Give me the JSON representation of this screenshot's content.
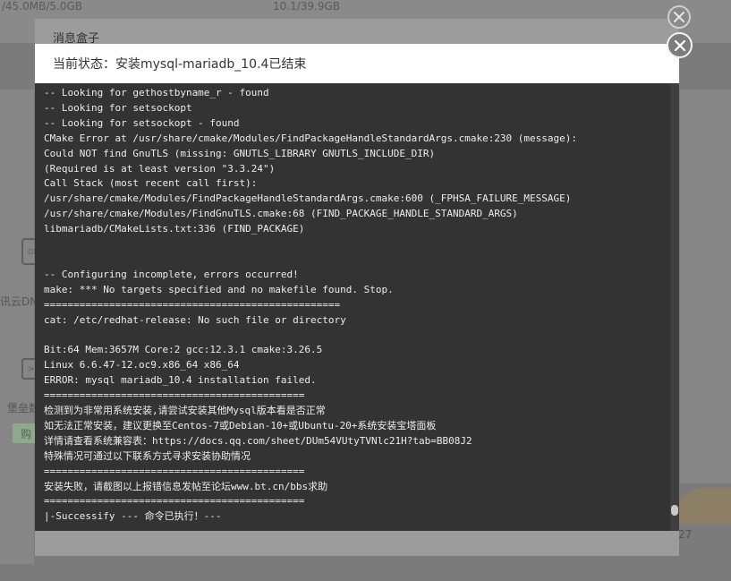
{
  "background": {
    "stats": [
      "/45.0MB/5.0GB",
      "10.1/39.9GB"
    ],
    "dns_icon_text": "DN",
    "dns_label": "讯云DN",
    "bastion_label": "堡垒数",
    "buy_label": "购",
    "corner_number": "27"
  },
  "dialog_back": {
    "title": "消息盒子"
  },
  "dialog": {
    "status_prefix": "当前状态：",
    "status_value": "安装mysql-mariadb_10.4已结束",
    "scroll_position": 0.97
  },
  "console": {
    "lines": [
      "-- Looking for gethostbyname_r - found",
      "-- Looking for setsockopt",
      "-- Looking for setsockopt - found",
      "CMake Error at /usr/share/cmake/Modules/FindPackageHandleStandardArgs.cmake:230 (message):",
      "Could NOT find GnuTLS (missing: GNUTLS_LIBRARY GNUTLS_INCLUDE_DIR)",
      "(Required is at least version \"3.3.24\")",
      "Call Stack (most recent call first):",
      "/usr/share/cmake/Modules/FindPackageHandleStandardArgs.cmake:600 (_FPHSA_FAILURE_MESSAGE)",
      "/usr/share/cmake/Modules/FindGnuTLS.cmake:68 (FIND_PACKAGE_HANDLE_STANDARD_ARGS)",
      "libmariadb/CMakeLists.txt:336 (FIND_PACKAGE)",
      "",
      "",
      "-- Configuring incomplete, errors occurred!",
      "make: *** No targets specified and no makefile found. Stop.",
      "==================================================",
      "cat: /etc/redhat-release: No such file or directory",
      "",
      "Bit:64 Mem:3657M Core:2 gcc:12.3.1 cmake:3.26.5",
      "Linux 6.6.47-12.oc9.x86_64 x86_64",
      "ERROR: mysql mariadb_10.4 installation failed.",
      "============================================",
      "检测到为非常用系统安装,请尝试安装其他Mysql版本看是否正常",
      "如无法正常安装，建议更换至Centos-7或Debian-10+或Ubuntu-20+系统安装宝塔面板",
      "详情请查看系统兼容表：https://docs.qq.com/sheet/DUm54VUtyTVNlc21H?tab=BB08J2",
      "特殊情况可通过以下联系方式寻求安装协助情况",
      "============================================",
      "安装失败，请截图以上报错信息发帖至论坛www.bt.cn/bbs求助",
      "============================================",
      "|-Successify --- 命令已执行！---"
    ]
  }
}
